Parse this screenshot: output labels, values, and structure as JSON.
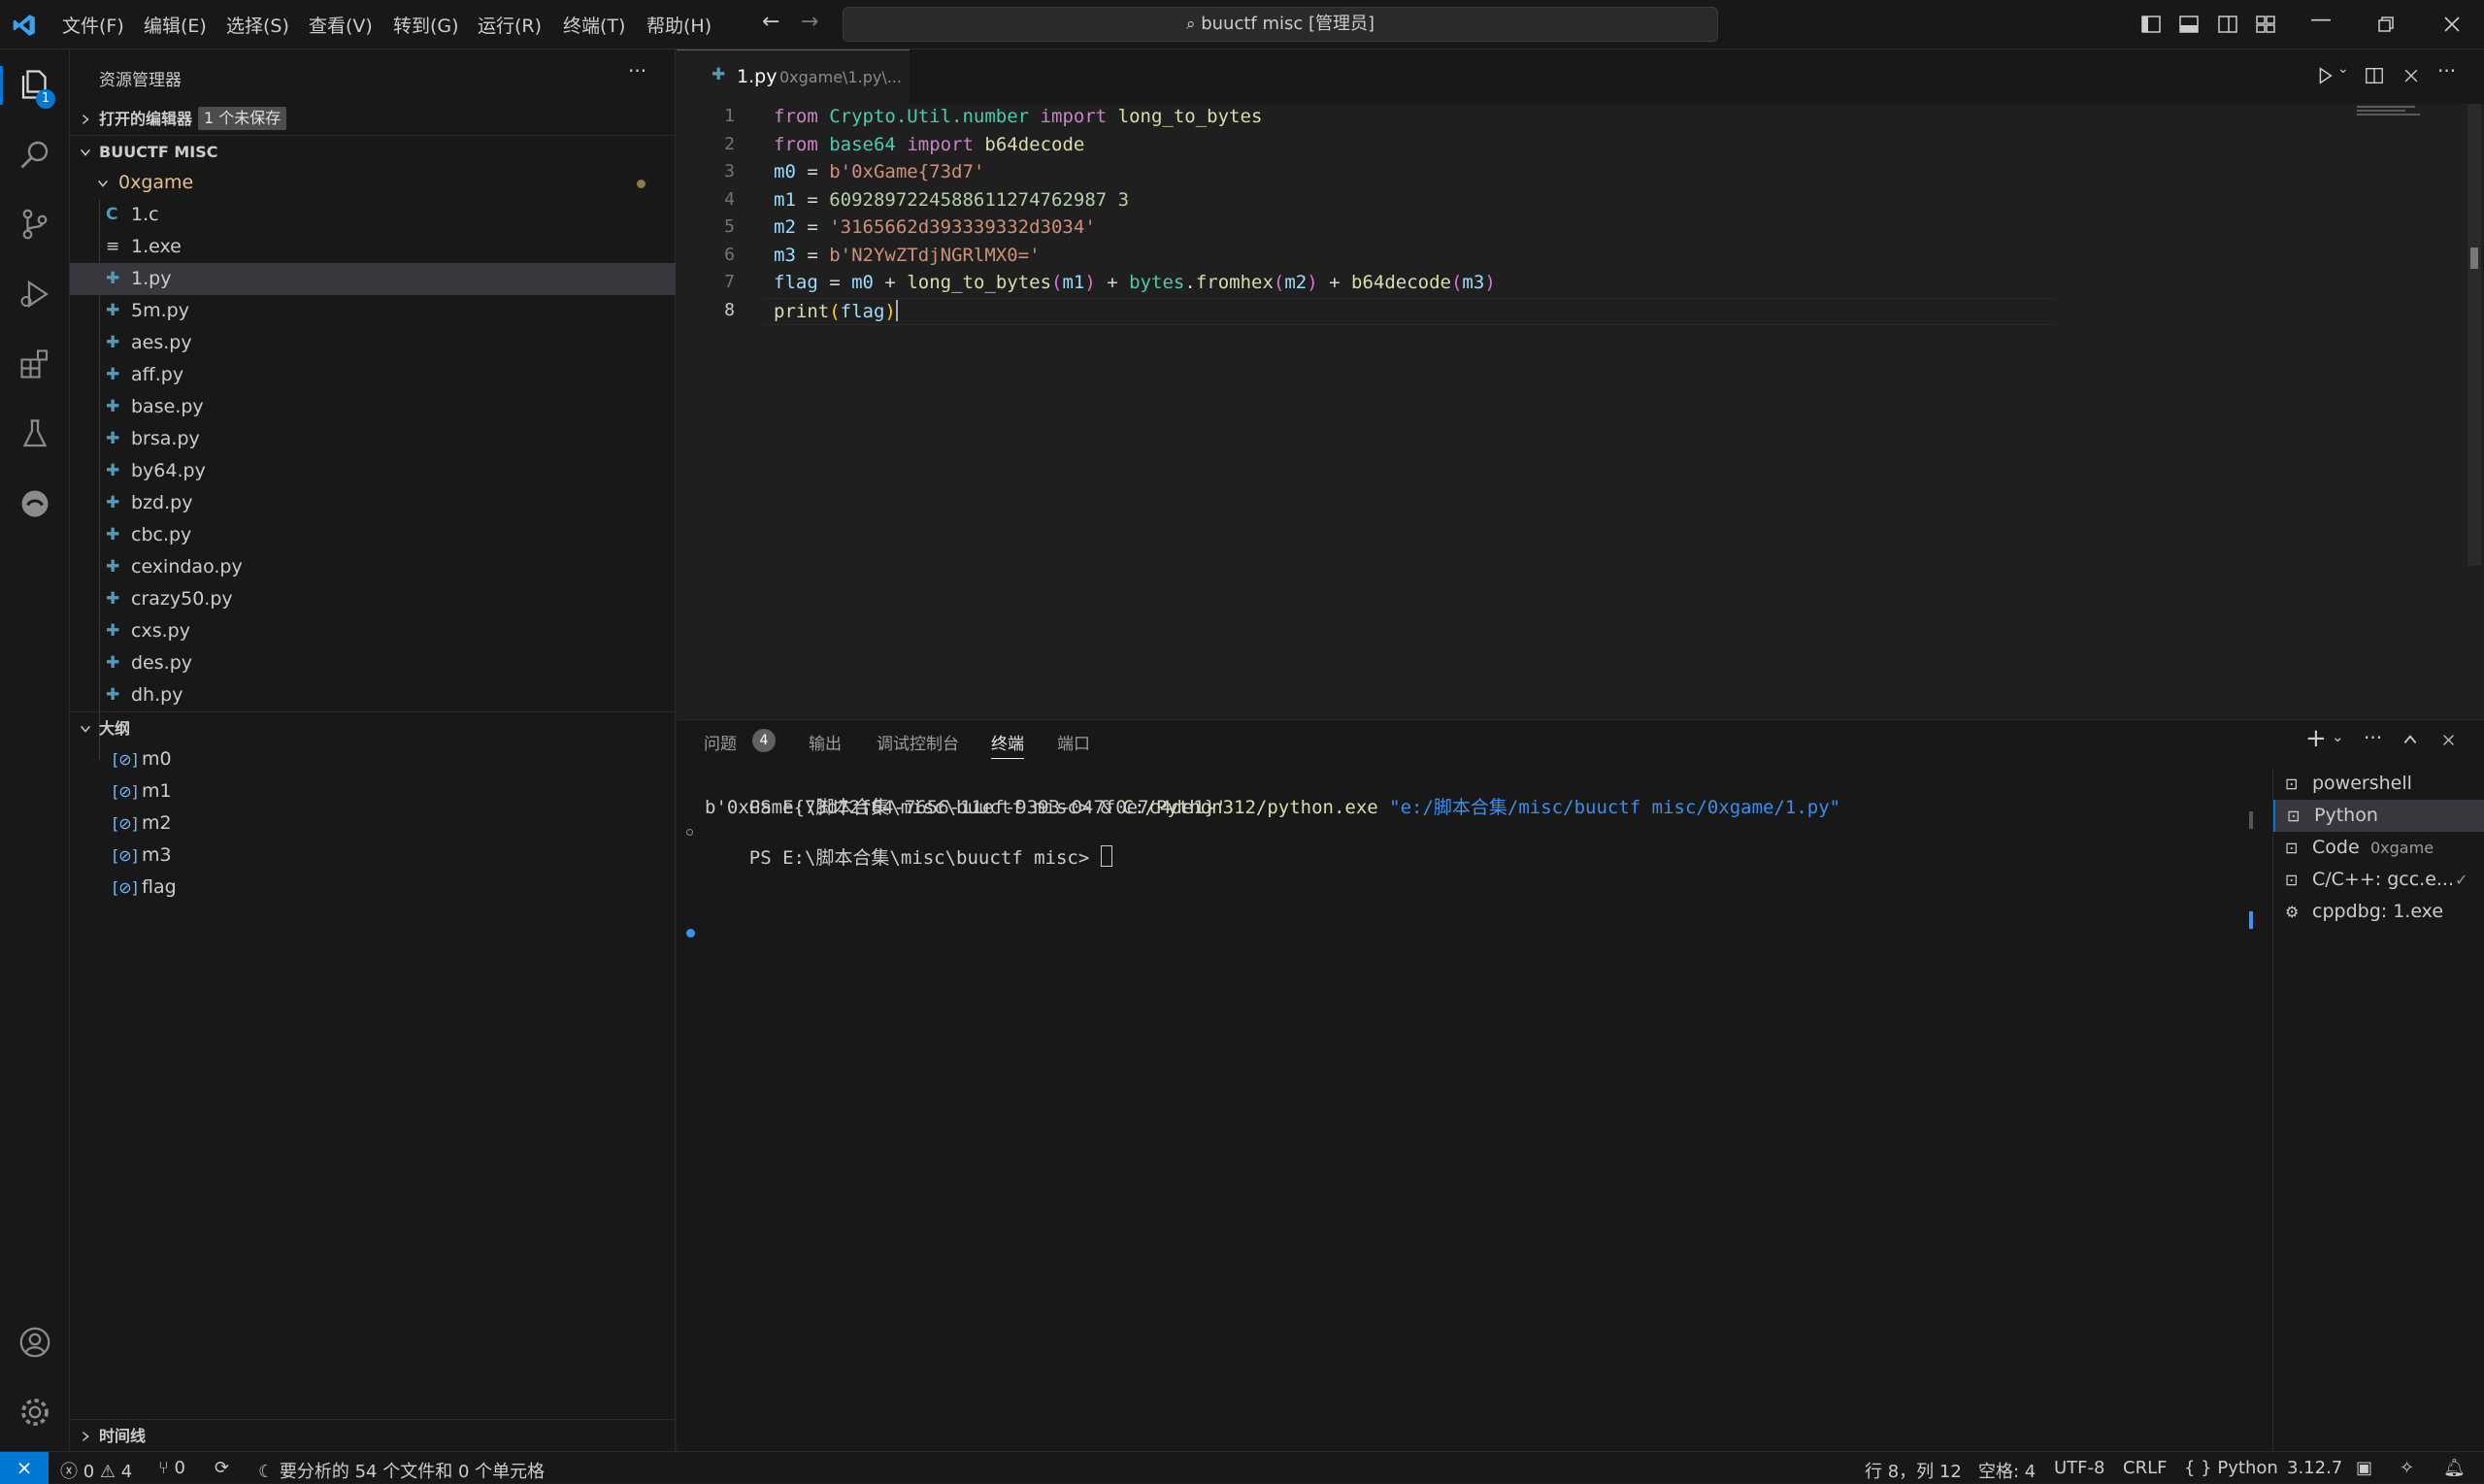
{
  "window": {
    "title": "buuctf misc [管理员]",
    "menu": [
      "文件(F)",
      "编辑(E)",
      "选择(S)",
      "查看(V)",
      "转到(G)",
      "运行(R)",
      "终端(T)",
      "帮助(H)"
    ]
  },
  "activity": {
    "explorer_badge": "1"
  },
  "sidebar": {
    "title": "资源管理器",
    "open_editors_label": "打开的编辑器",
    "unsaved_badge": "1 个未保存",
    "project_label": "BUUCTF MISC",
    "folder": "0xgame",
    "files": [
      {
        "name": "1.c",
        "icon": "C"
      },
      {
        "name": "1.exe",
        "icon": "≡"
      },
      {
        "name": "1.py",
        "icon": "py"
      },
      {
        "name": "5m.py",
        "icon": "py"
      },
      {
        "name": "aes.py",
        "icon": "py"
      },
      {
        "name": "aff.py",
        "icon": "py"
      },
      {
        "name": "base.py",
        "icon": "py"
      },
      {
        "name": "brsa.py",
        "icon": "py"
      },
      {
        "name": "by64.py",
        "icon": "py"
      },
      {
        "name": "bzd.py",
        "icon": "py"
      },
      {
        "name": "cbc.py",
        "icon": "py"
      },
      {
        "name": "cexindao.py",
        "icon": "py"
      },
      {
        "name": "crazy50.py",
        "icon": "py"
      },
      {
        "name": "cxs.py",
        "icon": "py"
      },
      {
        "name": "des.py",
        "icon": "py"
      },
      {
        "name": "dh.py",
        "icon": "py"
      }
    ],
    "outline_label": "大纲",
    "outline_items": [
      "m0",
      "m1",
      "m2",
      "m3",
      "flag"
    ],
    "outline_icon": "[⊘]",
    "timeline_label": "时间线"
  },
  "editor": {
    "tab_name": "1.py",
    "tab_path": "0xgame\\1.py\\...",
    "line_numbers": [
      "1",
      "2",
      "3",
      "4",
      "5",
      "6",
      "7",
      "8"
    ],
    "lines": [
      [
        "from",
        " ",
        "Crypto.Util.number",
        " ",
        "import",
        " ",
        "long_to_bytes"
      ],
      [
        "from",
        " ",
        "base64",
        " ",
        "import",
        " ",
        "b64decode"
      ],
      [
        "m0",
        " = ",
        "b'0xGame{73d7'"
      ],
      [
        "m1",
        " = ",
        "6092897224588611274762987 3"
      ],
      [
        "m2",
        " = ",
        "'3165662d393339332d3034'"
      ],
      [
        "m3",
        " = ",
        "b'N2YwZTdjNGRlMX0='"
      ],
      [
        "flag",
        " = ",
        "m0",
        " + ",
        "long_to_bytes",
        "(",
        "m1",
        ")",
        " + ",
        "bytes",
        ".",
        "fromhex",
        "(",
        "m2",
        ")",
        " + ",
        "b64decode",
        "(",
        "m3",
        ")"
      ],
      [
        "print",
        "(",
        "flag",
        ")"
      ]
    ]
  },
  "panel": {
    "tabs": [
      "问题",
      "输出",
      "调试控制台",
      "终端",
      "端口"
    ],
    "problems_count": "4",
    "terminal_lines": [
      {
        "prompt": "PS E:\\脚本合集\\misc\\buuctf misc> & ",
        "cmd": "C:/Python312/python.exe",
        "arg": " \"e:/脚本合集/misc/buuctf misc/0xgame/1.py\""
      },
      {
        "text": "b'0xGame{73d72f64-7656-11ef-9393-047f0e7c4de1}'"
      },
      {
        "prompt": "PS E:\\脚本合集\\misc\\buuctf misc> "
      }
    ],
    "terminals": [
      {
        "name": "powershell",
        "sub": ""
      },
      {
        "name": "Python",
        "sub": ""
      },
      {
        "name": "Code",
        "sub": "0xgame"
      },
      {
        "name": "C/C++: gcc.e...",
        "sub": "✓"
      },
      {
        "name": "cppdbg: 1.exe",
        "sub": ""
      }
    ]
  },
  "statusbar": {
    "errors": "0",
    "warnings": "4",
    "ports": "0",
    "analysis": "要分析的 54 个文件和 0 个单元格",
    "cursor": "行 8，列 12",
    "spaces": "空格: 4",
    "encoding": "UTF-8",
    "eol": "CRLF",
    "language": "Python",
    "version": "3.12.7"
  },
  "colors": {
    "accent": "#0078d4",
    "background": "#1f1f1f",
    "sidebar": "#181818"
  }
}
